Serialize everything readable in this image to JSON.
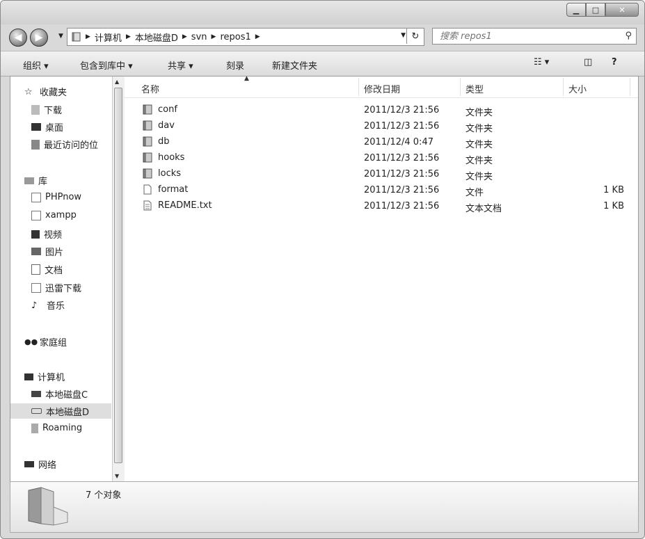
{
  "window": {
    "minimize_icon": "minimize-icon",
    "maximize_icon": "maximize-icon",
    "close_icon": "close-icon"
  },
  "address": {
    "segments": [
      "计算机",
      "本地磁盘D",
      "svn",
      "repos1"
    ]
  },
  "search": {
    "placeholder": "搜索 repos1"
  },
  "toolbar": {
    "organize": "组织 ▾",
    "include_library": "包含到库中 ▾",
    "share": "共享 ▾",
    "burn": "刻录",
    "new_folder": "新建文件夹"
  },
  "nav": {
    "favorites": "收藏夹",
    "downloads": "下载",
    "desktop": "桌面",
    "recent": "最近访问的位",
    "libraries": "库",
    "phpnow": "PHPnow",
    "xampp": "xampp",
    "videos": "视频",
    "pictures": "图片",
    "documents": "文档",
    "xunlei": "迅雷下载",
    "music": "音乐",
    "homegroup": "家庭组",
    "computer": "计算机",
    "disk_c": "本地磁盘C",
    "disk_d": "本地磁盘D",
    "roaming": "Roaming",
    "network": "网络"
  },
  "columns": {
    "name": "名称",
    "date": "修改日期",
    "type": "类型",
    "size": "大小"
  },
  "files": [
    {
      "name": "conf",
      "date": "2011/12/3 21:56",
      "type": "文件夹",
      "size": ""
    },
    {
      "name": "dav",
      "date": "2011/12/3 21:56",
      "type": "文件夹",
      "size": ""
    },
    {
      "name": "db",
      "date": "2011/12/4 0:47",
      "type": "文件夹",
      "size": ""
    },
    {
      "name": "hooks",
      "date": "2011/12/3 21:56",
      "type": "文件夹",
      "size": ""
    },
    {
      "name": "locks",
      "date": "2011/12/3 21:56",
      "type": "文件夹",
      "size": ""
    },
    {
      "name": "format",
      "date": "2011/12/3 21:56",
      "type": "文件",
      "size": "1 KB"
    },
    {
      "name": "README.txt",
      "date": "2011/12/3 21:56",
      "type": "文本文档",
      "size": "1 KB"
    }
  ],
  "status": {
    "count": "7 个对象"
  }
}
